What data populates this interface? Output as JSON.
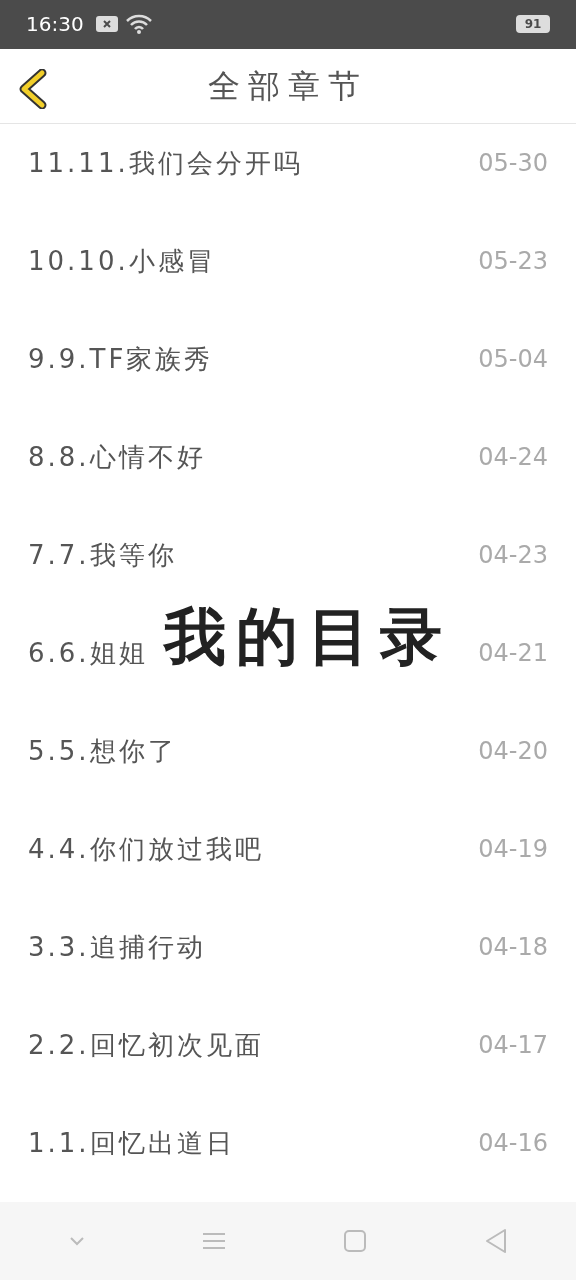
{
  "status_bar": {
    "time": "16:30",
    "battery": "91"
  },
  "header": {
    "title": "全部章节"
  },
  "chapters": [
    {
      "title": "11.11.我们会分开吗",
      "date": "05-30"
    },
    {
      "title": "10.10.小感冒",
      "date": "05-23"
    },
    {
      "title": "9.9.TF家族秀",
      "date": "05-04"
    },
    {
      "title": "8.8.心情不好",
      "date": "04-24"
    },
    {
      "title": "7.7.我等你",
      "date": "04-23"
    },
    {
      "title": "6.6.姐姐",
      "date": "04-21"
    },
    {
      "title": "5.5.想你了",
      "date": "04-20"
    },
    {
      "title": "4.4.你们放过我吧",
      "date": "04-19"
    },
    {
      "title": "3.3.追捕行动",
      "date": "04-18"
    },
    {
      "title": "2.2.回忆初次见面",
      "date": "04-17"
    },
    {
      "title": "1.1.回忆出道日",
      "date": "04-16"
    }
  ],
  "overlay_title": "我的目录"
}
